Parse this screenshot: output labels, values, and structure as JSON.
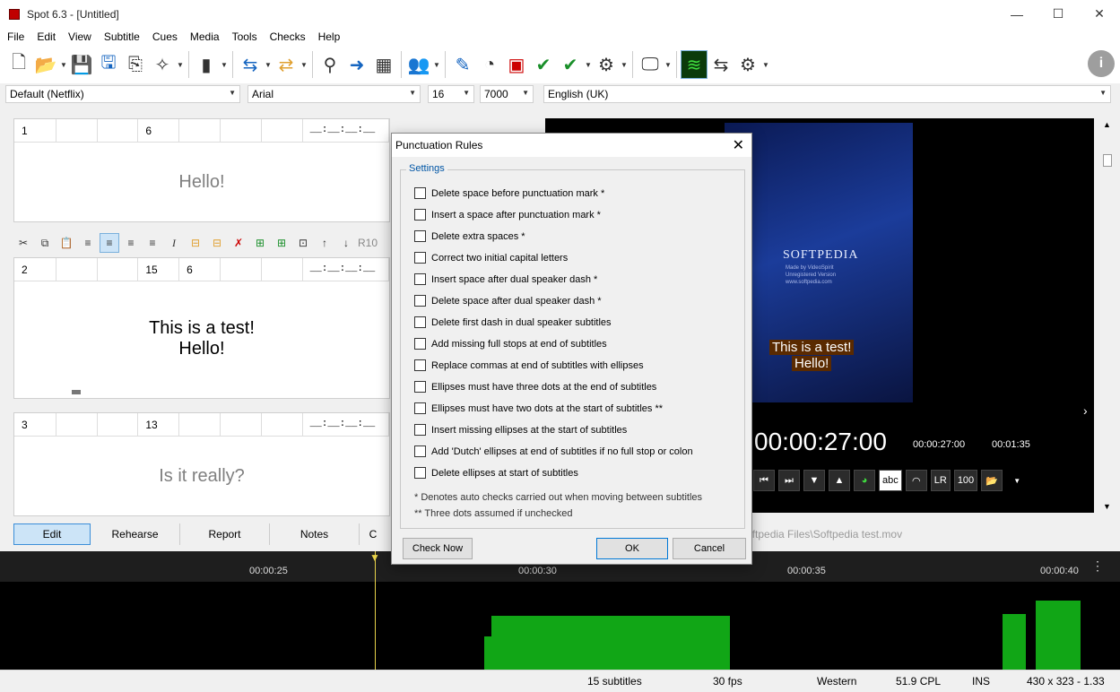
{
  "window": {
    "title": "Spot 6.3 - [Untitled]",
    "minimize": "—",
    "maximize": "☐",
    "close": "✕"
  },
  "menu": [
    "File",
    "Edit",
    "View",
    "Subtitle",
    "Cues",
    "Media",
    "Tools",
    "Checks",
    "Help"
  ],
  "format_bar": {
    "style": "Default (Netflix)",
    "font": "Arial",
    "size": "16",
    "duration": "7000",
    "language": "English (UK)"
  },
  "subtitles": [
    {
      "num": "1",
      "field2": "6",
      "timecode": "__:__:__:__",
      "lines": [
        "Hello!"
      ]
    },
    {
      "num": "2",
      "field1": "15",
      "field2": "6",
      "timecode": "__:__:__:__",
      "lines": [
        "This is a test!",
        "Hello!"
      ]
    },
    {
      "num": "3",
      "field1": "13",
      "timecode": "__:__:__:__",
      "lines": [
        "Is it really?"
      ]
    }
  ],
  "edit_tools": {
    "ref": "R10"
  },
  "tabs": [
    "Edit",
    "Rehearse",
    "Report",
    "Notes",
    "C"
  ],
  "video": {
    "overlay_lines": [
      "This is a test!",
      "Hello!"
    ],
    "poster_brand": "SOFTPEDIA",
    "poster_lines": [
      "Made by VideoSpirit",
      "Unregistered Version",
      "www.softpedia.com"
    ],
    "current_time": "00:00:27:00",
    "time_a": "00:00:27:00",
    "time_b": "00:01:35",
    "btn_lr": "LR",
    "btn_100": "100",
    "btn_abc": "abc",
    "file_path": "oftpedia Files\\Softpedia test.mov"
  },
  "timeline": {
    "labels": [
      "00:00:25",
      "00:00:30",
      "00:00:35",
      "00:00:40"
    ],
    "menu": "⋮"
  },
  "status": {
    "subtitles": "15 subtitles",
    "fps": "30 fps",
    "encoding": "Western",
    "cpl": "51.9 CPL",
    "mode": "INS",
    "dims": "430 x 323 - 1.33"
  },
  "dialog": {
    "title": "Punctuation Rules",
    "group": "Settings",
    "options": [
      "Delete space before punctuation mark *",
      "Insert a space after punctuation mark *",
      "Delete extra spaces *",
      "Correct two initial capital letters",
      "Insert space after dual speaker dash *",
      "Delete space after dual speaker dash *",
      "Delete first dash in dual speaker subtitles",
      "Add missing full stops at end of subtitles",
      "Replace commas at end of subtitles with ellipses",
      "Ellipses must have three dots at the end of subtitles",
      "Ellipses must have two dots at the start of subtitles **",
      "Insert missing ellipses at the start of subtitles",
      "Add 'Dutch' ellipses at end of subtitles if no full stop or colon",
      "Delete ellipses at start of subtitles"
    ],
    "note1": "*  Denotes auto checks carried out when moving between subtitles",
    "note2": "**  Three dots assumed if unchecked",
    "btn_check": "Check Now",
    "btn_ok": "OK",
    "btn_cancel": "Cancel"
  }
}
